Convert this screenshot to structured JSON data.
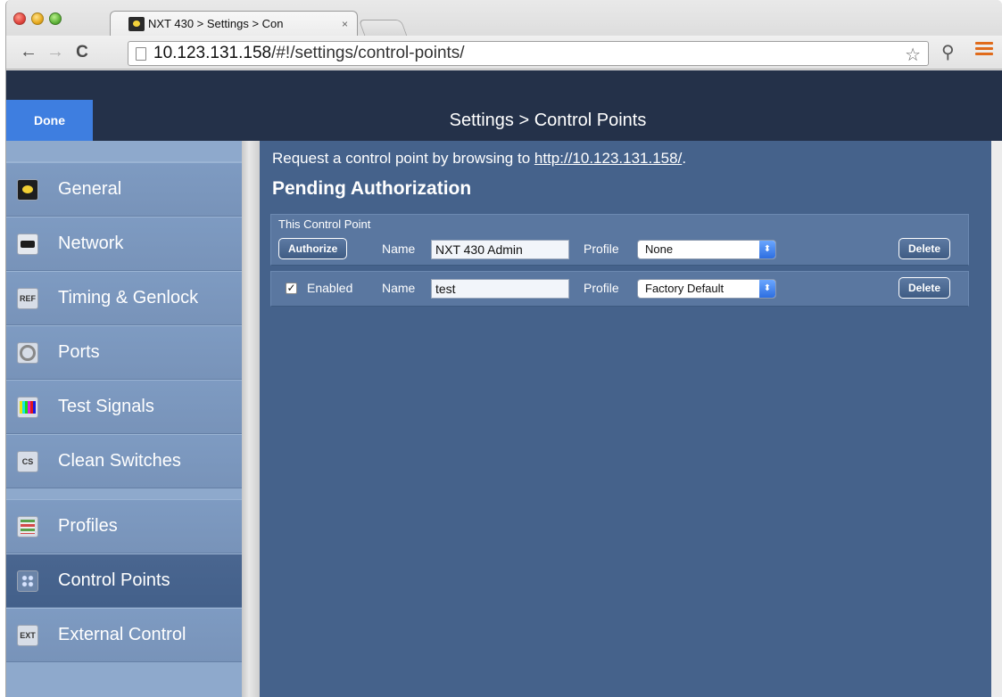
{
  "browser": {
    "tab_title": "NXT 430 > Settings > Con",
    "tab_close": "×",
    "url_host": "10.123.131.158",
    "url_path": "/#!/settings/control-points/",
    "back": "←",
    "forward": "→",
    "reload": "C",
    "star": "☆",
    "wrench": "⚲"
  },
  "header": {
    "done_label": "Done",
    "title": "Settings > Control Points"
  },
  "sidebar": {
    "items": [
      {
        "label": "General",
        "icon": "general-icon",
        "active": false
      },
      {
        "label": "Network",
        "icon": "network-icon",
        "active": false
      },
      {
        "label": "Timing & Genlock",
        "icon": "timing-genlock-icon",
        "icon_text": "REF",
        "active": false
      },
      {
        "label": "Ports",
        "icon": "ports-icon",
        "active": false
      },
      {
        "label": "Test Signals",
        "icon": "test-signals-icon",
        "active": false
      },
      {
        "label": "Clean Switches",
        "icon": "clean-switches-icon",
        "icon_text": "CS",
        "active": false
      },
      {
        "label": "Profiles",
        "icon": "profiles-icon",
        "active": false
      },
      {
        "label": "Control Points",
        "icon": "control-points-icon",
        "active": true
      },
      {
        "label": "External Control",
        "icon": "external-control-icon",
        "icon_text": "EXT",
        "active": false
      }
    ]
  },
  "main": {
    "request_text": "Request a control point by browsing to ",
    "request_link": "http://10.123.131.158/",
    "request_end": ".",
    "pending_title": "Pending Authorization",
    "rows": [
      {
        "caption": "This Control Point",
        "action_label": "Authorize",
        "name_label": "Name",
        "name_value": "NXT 430 Admin",
        "profile_label": "Profile",
        "profile_value": "None",
        "delete_label": "Delete"
      },
      {
        "check_mark": "✓",
        "enabled_label": "Enabled",
        "name_label": "Name",
        "name_value": "test",
        "profile_label": "Profile",
        "profile_value": "Factory Default",
        "delete_label": "Delete"
      }
    ],
    "select_arrow": "⬍"
  }
}
